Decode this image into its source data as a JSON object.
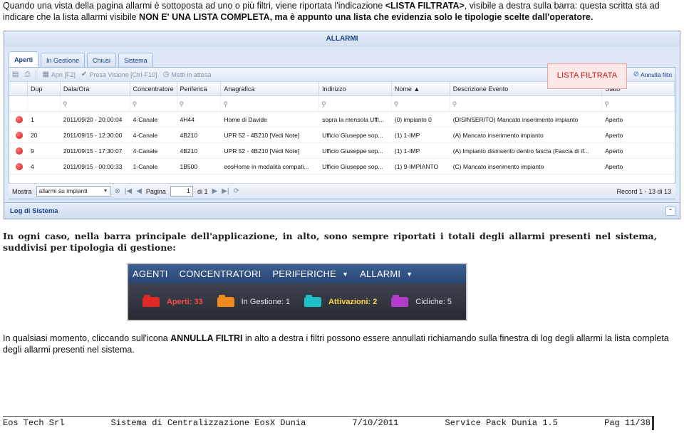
{
  "intro": {
    "part1": "Quando una vista della pagina allarmi è sottoposta ad uno o più filtri, viene riportata l'indicazione ",
    "tag": "<LISTA FILTRATA>",
    "part2": ", visibile a destra sulla barra: questa scritta sta ad indicare che la lista allarmi visibile ",
    "emph": "NON E' UNA LISTA COMPLETA, ma è appunto una lista che evidenzia solo le tipologie scelte dall'operatore."
  },
  "alarms_window": {
    "title": "ALLARMI",
    "tabs": [
      "Aperti",
      "In Gestione",
      "Chiusi",
      "Sistema"
    ],
    "toolbar": {
      "print_icon": "printer-icon",
      "open_label": "Apri [F2]",
      "presa_label": "Presa Visione [Ctrl-F10]",
      "attesa_label": "Metti in attesa",
      "lista_filtrata": "LISTA FILTRATA",
      "annulla_label": "Annulla filtri"
    },
    "columns": [
      "",
      "Dup",
      "Data/Ora",
      "Concentratore",
      "Periferica",
      "Anagrafica",
      "Indirizzo",
      "Nome",
      "Descrizione Evento",
      "Stato"
    ],
    "rows": [
      {
        "dup": "1",
        "datetime": "2011/09/20 - 20:00:04",
        "conc": "4-Canale",
        "perif": "4H44",
        "anag": "Home di Davide",
        "ind": "sopra la mensola Uffi...",
        "nome": "(0) impianto 0",
        "desc": "(DISINSERITO) Mancato inserimento impianto",
        "stato": "Aperto"
      },
      {
        "dup": "20",
        "datetime": "2011/09/15 - 12:30:00",
        "conc": "4-Canale",
        "perif": "4B210",
        "anag": "UPR 52 - 4B210 [Vedi Note]",
        "ind": "Ufficio Giuseppe sop...",
        "nome": "(1) 1-IMP",
        "desc": "(A) Mancato inserimento impianto",
        "stato": "Aperto"
      },
      {
        "dup": "9",
        "datetime": "2011/09/15 - 17:30:07",
        "conc": "4-Canale",
        "perif": "4B210",
        "anag": "UPR 52 - 4B210 [Vedi Note]",
        "ind": "Ufficio Giuseppe sop...",
        "nome": "(1) 1-IMP",
        "desc": "(A) Impianto disinserito dentro fascia (Fascia di if...",
        "stato": "Aperto"
      },
      {
        "dup": "4",
        "datetime": "2011/09/15 - 00:00:33",
        "conc": "1-Canale",
        "perif": "1B500",
        "anag": "eosHome in modalità compati...",
        "ind": "Ufficio Giuseppe sop...",
        "nome": "(1) 9-IMPIANTO",
        "desc": "(C) Mancato inserimento impianto",
        "stato": "Aperto"
      }
    ],
    "pager": {
      "mostra_label": "Mostra",
      "mostra_value": "allarmi su impianti",
      "page_label": "Pagina",
      "page_value": "1",
      "of_label": "di 1",
      "record": "Record 1 - 13 di 13"
    },
    "log_label": "Log di Sistema"
  },
  "mid_text": "In ogni caso, nella barra principale dell'applicazione, in alto, sono sempre riportati i totali degli allarmi presenti nel sistema, suddivisi per tipologia di gestione:",
  "topbar": {
    "menu": [
      {
        "label": "AGENTI",
        "caret": false
      },
      {
        "label": "CONCENTRATORI",
        "caret": false
      },
      {
        "label": "PERIFERICHE",
        "caret": true
      },
      {
        "label": "ALLARMI",
        "caret": true
      }
    ],
    "stats": [
      {
        "label": "Aperti: 33",
        "color": "#e02828",
        "text_color": "#ff4a4a"
      },
      {
        "label": "In Gestione: 1",
        "color": "#f08a1c",
        "text_color": "#e8e8e8"
      },
      {
        "label": "Attivazioni: 2",
        "color": "#1ec0c8",
        "text_color": "#ffd24a"
      },
      {
        "label": "Cicliche: 5",
        "color": "#b23cc8",
        "text_color": "#e8e8e8"
      }
    ]
  },
  "last_text": {
    "part1": "In qualsiasi momento, cliccando sull'icona ",
    "bold": "ANNULLA FILTRI",
    "part2": " in alto a destra i filtri possono essere annullati richiamando sulla finestra di log degli allarmi la lista completa degli allarmi presenti nel sistema."
  },
  "footer": {
    "company": "Eos Tech Srl",
    "system": "Sistema di Centralizzazione EosX Dunia",
    "date": "7/10/2011",
    "sp": "Service Pack Dunia 1.5",
    "page": "Pag 11/38"
  }
}
